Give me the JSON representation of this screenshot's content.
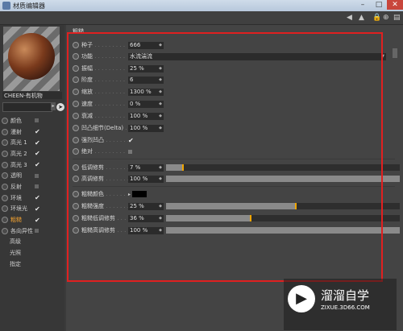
{
  "window": {
    "title": "材质编辑器"
  },
  "left_panel": {
    "material_name": "CHEEN-有机物",
    "channels": [
      {
        "label": "颜色",
        "checked": false
      },
      {
        "label": "漫射",
        "checked": true
      },
      {
        "label": "高光 1",
        "checked": true
      },
      {
        "label": "高光 2",
        "checked": true
      },
      {
        "label": "高光 3",
        "checked": true
      },
      {
        "label": "透明",
        "checked": false
      },
      {
        "label": "反射",
        "checked": false
      },
      {
        "label": "环境",
        "checked": true
      },
      {
        "label": "环境光",
        "checked": true
      },
      {
        "label": "粗糙",
        "checked": true,
        "active": true
      },
      {
        "label": "各向异性",
        "checked": false
      },
      {
        "label": "高级",
        "sub": true
      },
      {
        "label": "光照",
        "sub": true
      },
      {
        "label": "指定",
        "sub": true
      }
    ]
  },
  "panel": {
    "section_title": "粗糙",
    "seed": {
      "label": "种子",
      "value": "666"
    },
    "function": {
      "label": "功能",
      "value": "水流湍流"
    },
    "amplitude": {
      "label": "振幅",
      "value": "25 %"
    },
    "octave": {
      "label": "阶度",
      "value": "6"
    },
    "scale": {
      "label": "缩放",
      "value": "1300 %"
    },
    "speed": {
      "label": "速度",
      "value": "0 %"
    },
    "attenuation": {
      "label": "衰减",
      "value": "100 %"
    },
    "bump_delta": {
      "label": "凹凸细节(Delta)",
      "value": "100 %"
    },
    "bump_strength": {
      "label": "强烈凹凸",
      "checked": true
    },
    "absolute": {
      "label": "绝对",
      "checked": false
    },
    "low_clip": {
      "label": "低调修剪",
      "value": "7 %",
      "level": 0.07
    },
    "high_clip": {
      "label": "高调修剪",
      "value": "100 %",
      "level": 1.0
    },
    "rough_color": {
      "label": "粗糙颜色",
      "color": "#000000"
    },
    "rough_strength": {
      "label": "粗糙强度",
      "value": "25 %",
      "level": 0.55
    },
    "rough_low_clip": {
      "label": "粗糙低调修剪",
      "value": "36 %",
      "level": 0.36
    },
    "rough_high_clip": {
      "label": "粗糙高调修剪",
      "value": "100 %",
      "level": 1.0
    }
  },
  "watermark": {
    "brand": "溜溜自学",
    "url": "ZIXUE.3D66.COM"
  },
  "colors": {
    "accent": "#f0a500",
    "highlight_border": "#e02020",
    "active_channel": "#f0a030"
  }
}
